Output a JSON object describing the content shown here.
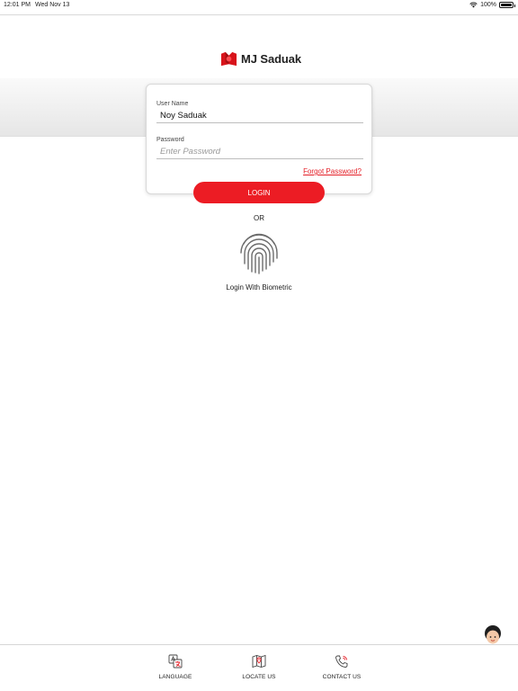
{
  "status_bar": {
    "time": "12:01 PM",
    "date": "Wed Nov 13",
    "battery": "100%"
  },
  "brand": {
    "name": "MJ Saduak",
    "accent": "#ec1c24"
  },
  "form": {
    "username_label": "User Name",
    "username_value": "Noy Saduak",
    "password_label": "Password",
    "password_placeholder": "Enter Password",
    "forgot_link": "Forgot Password?",
    "login_button": "LOGIN"
  },
  "alt_login": {
    "or_text": "OR",
    "biometric_label": "Login With Biometric",
    "icon": "fingerprint-icon"
  },
  "bottom_nav": [
    {
      "label": "LANGUAGE",
      "icon": "language-icon"
    },
    {
      "label": "LOCATE US",
      "icon": "map-icon"
    },
    {
      "label": "CONTACT US",
      "icon": "phone-icon"
    }
  ]
}
